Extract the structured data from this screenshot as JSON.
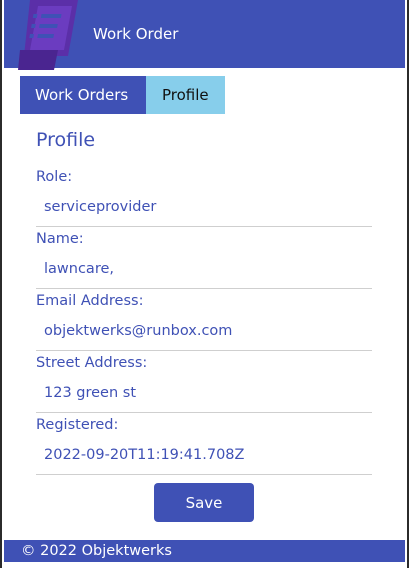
{
  "app": {
    "title": "Work Order"
  },
  "tabs": [
    {
      "label": "Work Orders"
    },
    {
      "label": "Profile"
    }
  ],
  "profile": {
    "title": "Profile",
    "fields": [
      {
        "label": "Role:",
        "value": "serviceprovider"
      },
      {
        "label": "Name:",
        "value": "lawncare,"
      },
      {
        "label": "Email Address:",
        "value": "objektwerks@runbox.com"
      },
      {
        "label": "Street Address:",
        "value": "123 green st"
      },
      {
        "label": "Registered:",
        "value": "2022-09-20T11:19:41.708Z"
      }
    ],
    "save_label": "Save"
  },
  "footer": {
    "text": "© 2022 Objektwerks"
  },
  "colors": {
    "primary": "#3f51b5",
    "tab_active": "#87ceeb"
  },
  "icons": {
    "logo": "work-order-document-icon"
  }
}
